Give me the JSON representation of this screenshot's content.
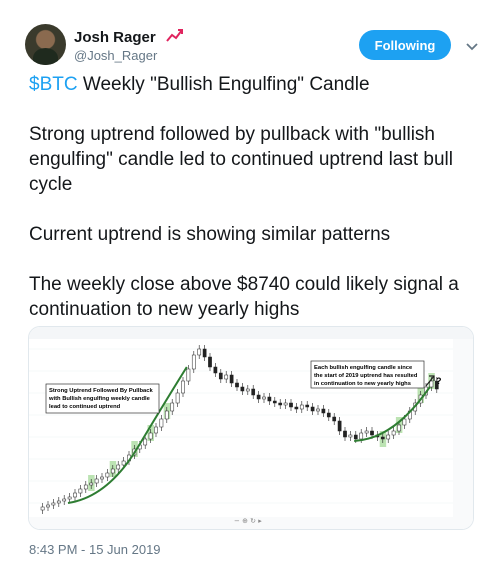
{
  "author": {
    "name": "Josh Rager",
    "handle": "@Josh_Rager",
    "badge_icon": "chart-up-icon"
  },
  "follow_button": {
    "label": "Following",
    "color": "#1da1f2"
  },
  "menu_icon": "chevron-down-icon",
  "tweet": {
    "cashtag": "$BTC",
    "line1_rest": " Weekly \"Bullish Engulfing\" Candle",
    "para2": "Strong uptrend followed by pullback with \"bullish engulfing\" candle led to continued uptrend last bull cycle",
    "para3": "Current uptrend is showing similar patterns",
    "para4": "The weekly close above $8740 could likely signal a continuation to new yearly highs"
  },
  "chart_image": {
    "annotation_left": [
      "Strong Uptrend Followed By Pullback",
      "with Bullish engulfing weekly candle",
      "lead to continued uptrend"
    ],
    "annotation_right": [
      "Each bullish engulfing candle since",
      "the start of 2019 uptrend has resulted",
      "in continuation to new yearly highs"
    ],
    "question_mark": "?",
    "up_color": "#ffffff",
    "down_color": "#222222",
    "highlight_color": "#a5d99a",
    "curve_color": "#2e7d32"
  },
  "timestamp": "8:43 PM - 15 Jun 2019"
}
